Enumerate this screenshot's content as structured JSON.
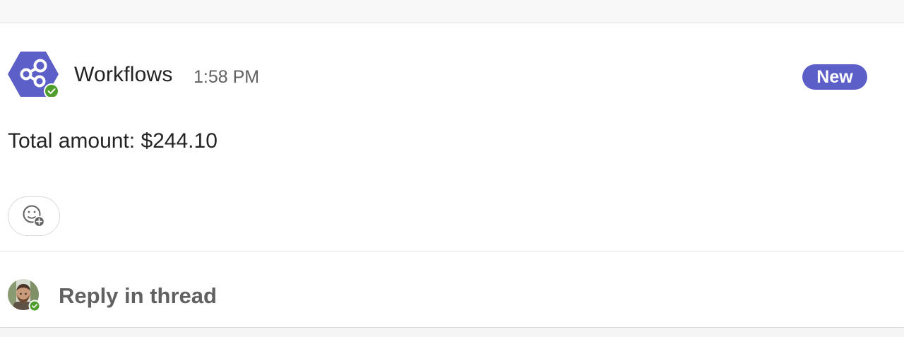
{
  "message": {
    "sender": "Workflows",
    "time": "1:58 PM",
    "badge": "New",
    "body": "Total amount: $244.10",
    "avatar_icon": "workflows-share-icon",
    "status_icon": "available-check-icon"
  },
  "reactions": {
    "add_reaction_icon": "emoji-add-icon"
  },
  "reply": {
    "label": "Reply in thread",
    "avatar_status_icon": "available-check-icon"
  },
  "colors": {
    "brand": "#5b5fc7",
    "badge_bg": "#5b5fc7",
    "status_green": "#4f9e2d",
    "text_primary": "#242424",
    "text_secondary": "#616161"
  }
}
